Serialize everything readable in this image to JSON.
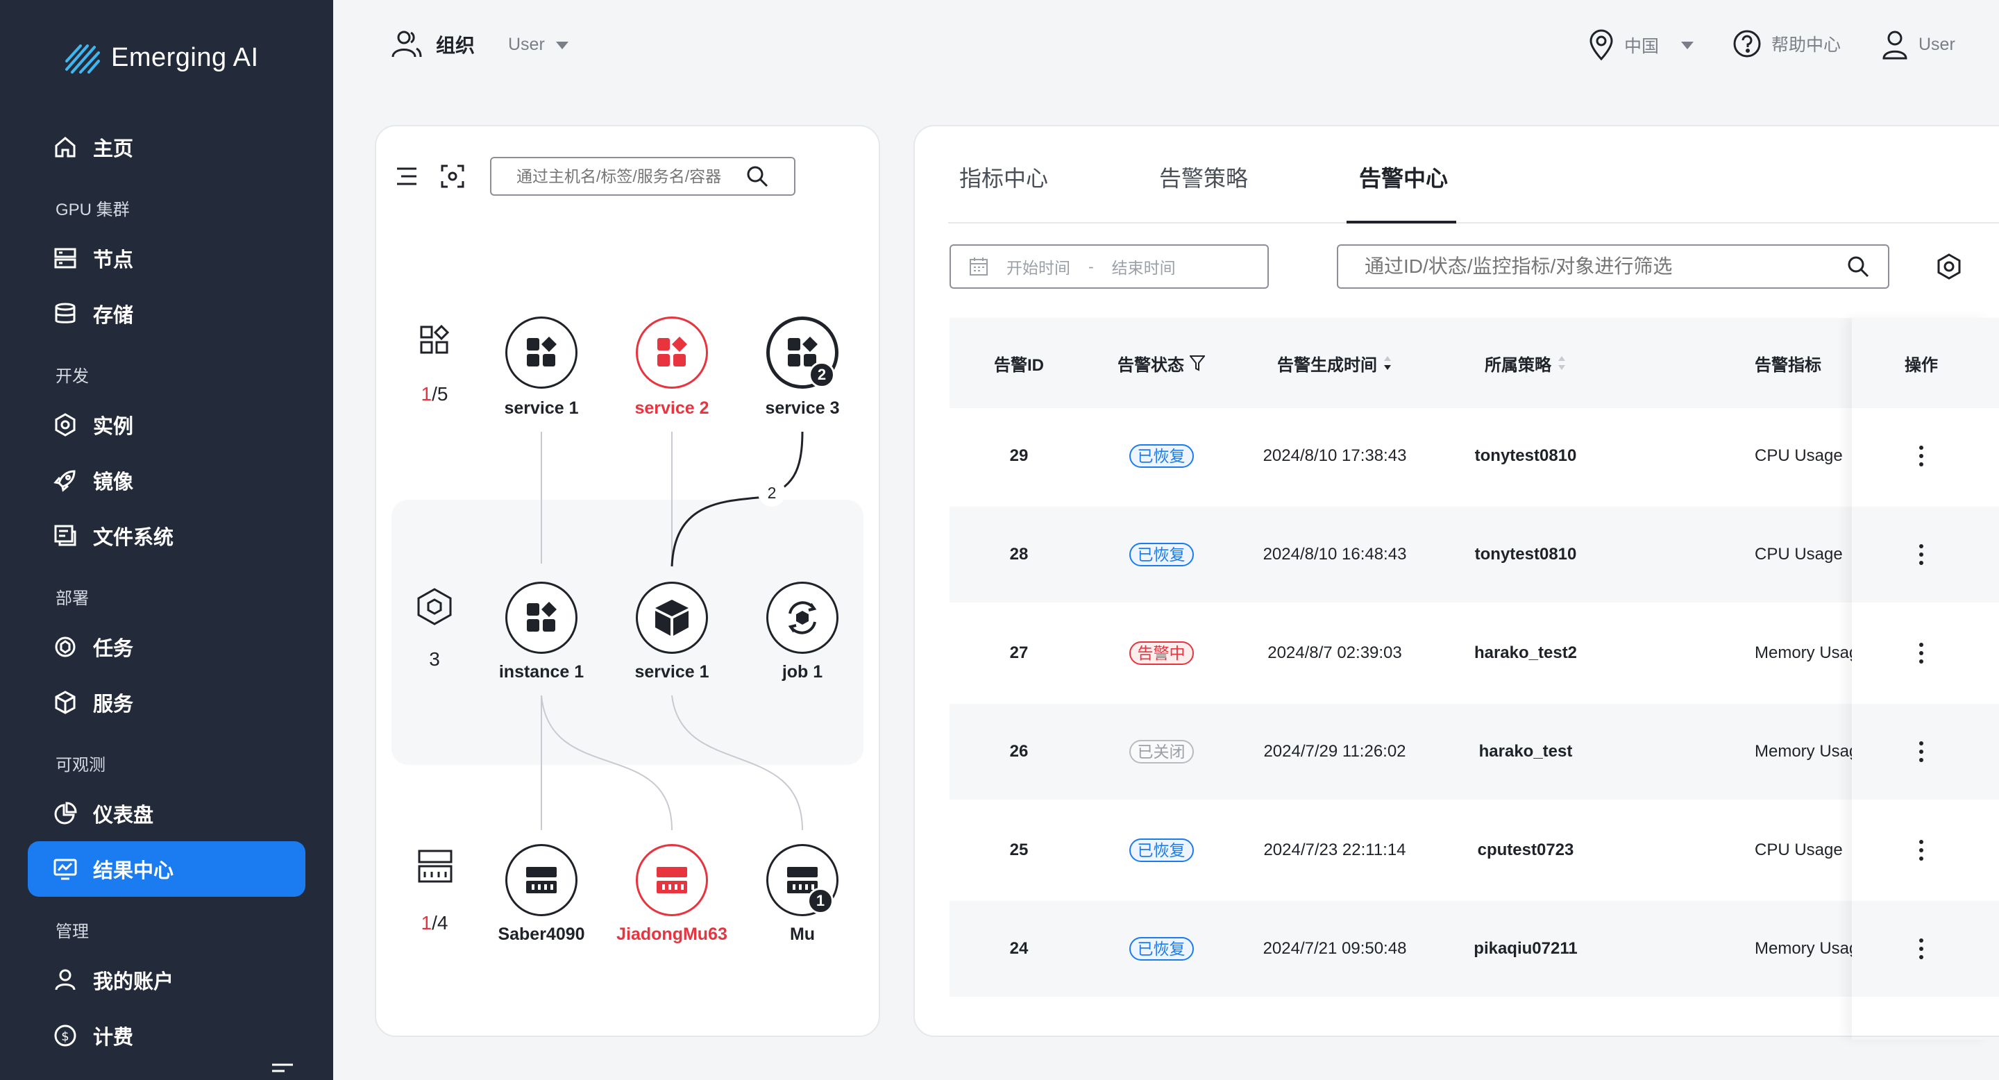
{
  "brand": {
    "name": "Emerging AI"
  },
  "sidebar": {
    "items": [
      {
        "label": "主页",
        "icon": "home-icon"
      },
      {
        "label": "节点",
        "icon": "server-icon"
      },
      {
        "label": "存储",
        "icon": "database-icon"
      },
      {
        "label": "实例",
        "icon": "hexagon-icon"
      },
      {
        "label": "镜像",
        "icon": "rocket-icon"
      },
      {
        "label": "文件系统",
        "icon": "file-system-icon"
      },
      {
        "label": "任务",
        "icon": "task-icon"
      },
      {
        "label": "服务",
        "icon": "cube-icon"
      },
      {
        "label": "仪表盘",
        "icon": "pie-chart-icon"
      },
      {
        "label": "结果中心",
        "icon": "monitor-alert-icon"
      },
      {
        "label": "我的账户",
        "icon": "user-icon"
      },
      {
        "label": "计费",
        "icon": "dollar-icon"
      }
    ],
    "sections": [
      "GPU 集群",
      "开发",
      "部署",
      "可观测",
      "管理"
    ],
    "active_item": "结果中心"
  },
  "topbar": {
    "org_label": "组织",
    "org_user": "User",
    "region": "中国",
    "help": "帮助中心",
    "user": "User"
  },
  "topology": {
    "search_placeholder": "通过主机名/标签/服务名/容器",
    "rows": [
      {
        "icon": "services-group-icon",
        "count_red": "1",
        "count_rest": "/5"
      },
      {
        "icon": "workload-icon",
        "count_red": "",
        "count_rest": "3"
      },
      {
        "icon": "host-icon",
        "count_red": "1",
        "count_rest": "/4"
      }
    ],
    "nodes": {
      "service1": "service 1",
      "service2": "service 2",
      "service3": "service 3",
      "service3_badge": "2",
      "instance1": "instance 1",
      "service_mid": "service 1",
      "job1": "job 1",
      "saber": "Saber4090",
      "jiadong": "JiadongMu63",
      "mu": "Mu",
      "mu_badge": "1"
    },
    "edge_label": "2"
  },
  "alerts": {
    "tabs": [
      "指标中心",
      "告警策略",
      "告警中心"
    ],
    "active_tab": "告警中心",
    "date_start_placeholder": "开始时间",
    "date_sep": "-",
    "date_end_placeholder": "结束时间",
    "filter_placeholder": "通过ID/状态/监控指标/对象进行筛选",
    "columns": [
      "告警ID",
      "告警状态",
      "告警生成时间",
      "所属策略",
      "告警指标",
      "操作"
    ],
    "rows": [
      {
        "id": "29",
        "status": "已恢复",
        "status_kind": "recovered",
        "time": "2024/8/10 17:38:43",
        "policy": "tonytest0810",
        "metric": "CPU Usage"
      },
      {
        "id": "28",
        "status": "已恢复",
        "status_kind": "recovered",
        "time": "2024/8/10 16:48:43",
        "policy": "tonytest0810",
        "metric": "CPU Usage"
      },
      {
        "id": "27",
        "status": "告警中",
        "status_kind": "alerting",
        "time": "2024/8/7 02:39:03",
        "policy": "harako_test2",
        "metric": "Memory Usage"
      },
      {
        "id": "26",
        "status": "已关闭",
        "status_kind": "closed",
        "time": "2024/7/29 11:26:02",
        "policy": "harako_test",
        "metric": "Memory Usage"
      },
      {
        "id": "25",
        "status": "已恢复",
        "status_kind": "recovered",
        "time": "2024/7/23 22:11:14",
        "policy": "cputest0723",
        "metric": "CPU Usage"
      },
      {
        "id": "24",
        "status": "已恢复",
        "status_kind": "recovered",
        "time": "2024/7/21 09:50:48",
        "policy": "pikaqiu07211",
        "metric": "Memory Usage"
      }
    ]
  },
  "colors": {
    "accent": "#1a7cf0",
    "sidebar_bg": "#232b3b",
    "alert_red": "#e8343f"
  }
}
